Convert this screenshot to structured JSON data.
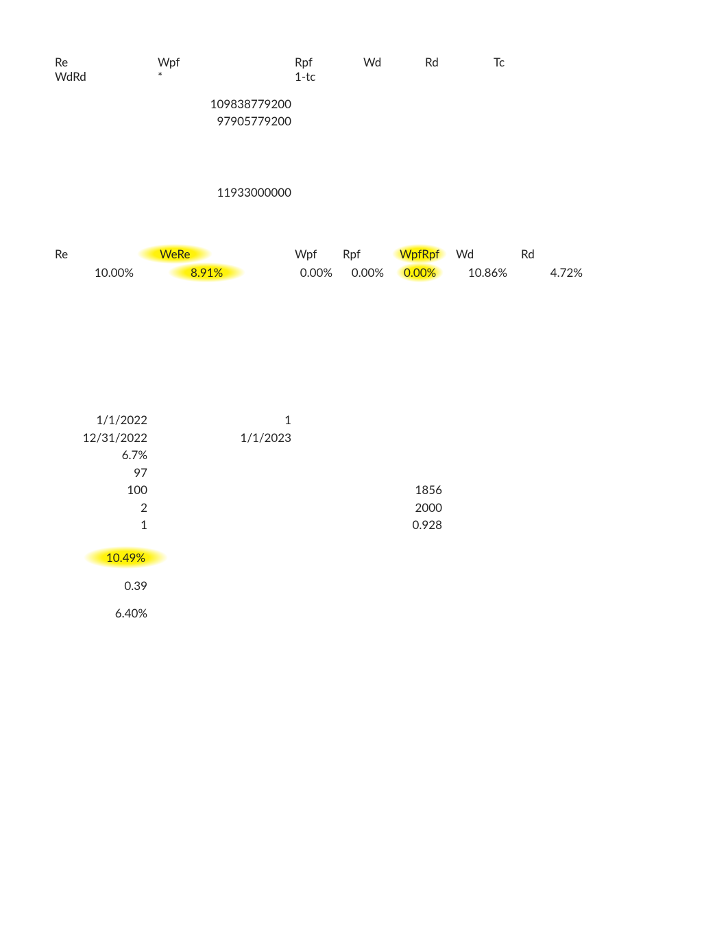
{
  "section1": {
    "headers": {
      "col1_line1": "Re",
      "col1_line2": "WdRd",
      "col2_line1": "Wpf",
      "col2_line2": "*",
      "col3_line1": "Rpf",
      "col3_line2": "1-tc",
      "col4": "Wd",
      "col5": "Rd",
      "col6": "Tc"
    },
    "numbers": {
      "n1": "109838779200",
      "n2": "97905779200",
      "n3": "11933000000"
    }
  },
  "section2": {
    "cols": [
      {
        "label": "Re",
        "value": "10.00%",
        "hl_label": false,
        "hl_value": false
      },
      {
        "label": "WeRe",
        "value": "8.91%",
        "hl_label": true,
        "hl_value": true
      },
      {
        "label": "Wpf",
        "value": "0.00%",
        "hl_label": false,
        "hl_value": false
      },
      {
        "label": "Rpf",
        "value": "0.00%",
        "hl_label": false,
        "hl_value": false
      },
      {
        "label": "WpfRpf",
        "value": "0.00%",
        "hl_label": true,
        "hl_value": true
      },
      {
        "label": "Wd",
        "value": "10.86%",
        "hl_label": false,
        "hl_value": false
      },
      {
        "label": "Rd",
        "value": "4.72%",
        "hl_label": false,
        "hl_value": false
      }
    ]
  },
  "section3": {
    "colA": [
      "1/1/2022",
      "12/31/2022",
      "6.7%",
      "97",
      "100",
      "2",
      "1"
    ],
    "colB": [
      "1",
      "1/1/2023"
    ],
    "colC": [
      "1856",
      "2000",
      "0.928"
    ],
    "extra": {
      "hl_value": "10.49%",
      "v2": "0.39",
      "v3": "6.40%"
    }
  }
}
